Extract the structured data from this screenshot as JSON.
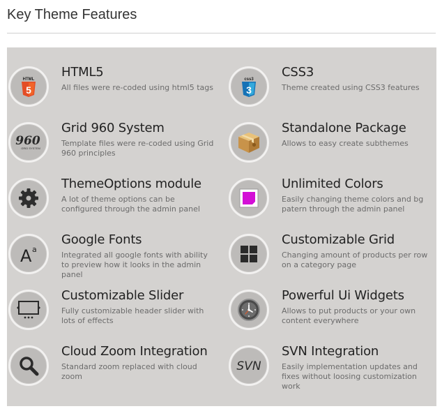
{
  "header": {
    "title": "Key Theme Features"
  },
  "features": [
    {
      "title": "HTML5",
      "desc": "All files were re-coded using html5 tags",
      "icon": "html5-icon"
    },
    {
      "title": "CSS3",
      "desc": "Theme created using CSS3 features",
      "icon": "css3-icon"
    },
    {
      "title": "Grid 960 System",
      "desc": "Template files were re-coded using Grid 960 principles",
      "icon": "grid960-icon"
    },
    {
      "title": "Standalone Package",
      "desc": "Allows to easy create subthemes",
      "icon": "package-icon"
    },
    {
      "title": "ThemeOptions module",
      "desc": "A lot of theme options can be configured through the admin panel",
      "icon": "gear-icon"
    },
    {
      "title": "Unlimited Colors",
      "desc": "Easily changing theme colors and bg patern through the admin panel",
      "icon": "color-swatch-icon"
    },
    {
      "title": "Google Fonts",
      "desc": "Integrated all google fonts with ability to preview how it looks in the admin panel",
      "icon": "font-icon"
    },
    {
      "title": "Customizable Grid",
      "desc": "Changing amount of products per row on a category page",
      "icon": "grid-icon"
    },
    {
      "title": "Customizable Slider",
      "desc": "Fully customizable header slider with lots of effects",
      "icon": "slider-icon"
    },
    {
      "title": "Powerful Ui Widgets",
      "desc": "Allows to put products or your own content everywhere",
      "icon": "widget-clock-icon"
    },
    {
      "title": "Cloud Zoom Integration",
      "desc": "Standard zoom replaced with cloud zoom",
      "icon": "magnifier-icon"
    },
    {
      "title": "SVN Integration",
      "desc": "Easily implementation updates and fixes without loosing customization work",
      "icon": "svn-icon"
    }
  ],
  "icon_labels": {
    "html5": "HTML",
    "css3": "css3",
    "grid960": "960",
    "grid960_sub": "GRID SYSTEM",
    "svn": "SVN",
    "font_a": "A",
    "font_a_sup": "a"
  },
  "colors": {
    "panel_bg": "#d4d2d0",
    "html5_orange": "#e44d26",
    "css3_blue": "#1572b6",
    "swatch_magenta": "#d30fd6"
  }
}
